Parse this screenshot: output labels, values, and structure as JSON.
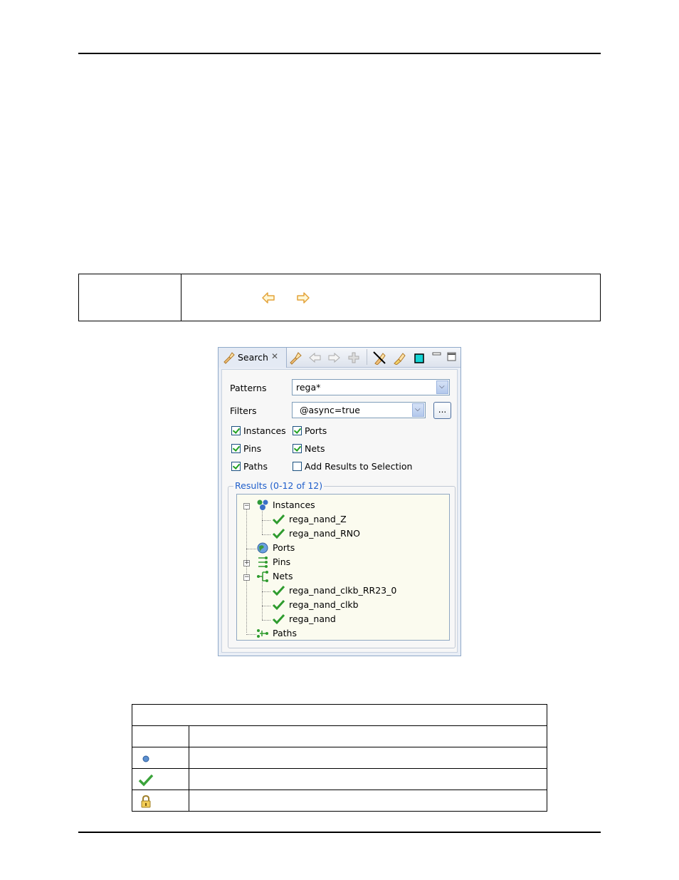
{
  "panel": {
    "tab_label": "Search",
    "patterns_label": "Patterns",
    "patterns_value": "rega*",
    "filters_label": "Filters",
    "filters_value": "@async=true",
    "browse_button": "...",
    "checkboxes": {
      "instances": {
        "label": "Instances",
        "checked": true
      },
      "ports": {
        "label": "Ports",
        "checked": true
      },
      "pins": {
        "label": "Pins",
        "checked": true
      },
      "nets": {
        "label": "Nets",
        "checked": true
      },
      "paths": {
        "label": "Paths",
        "checked": true
      },
      "add_results": {
        "label": "Add Results to Selection",
        "checked": false
      }
    },
    "results_title": "Results (0-12 of 12)",
    "tree": {
      "instances": "Instances",
      "instance_items": [
        "rega_nand_Z",
        "rega_nand_RNO"
      ],
      "ports": "Ports",
      "pins": "Pins",
      "nets": "Nets",
      "net_items": [
        "rega_nand_clkb_RR23_0",
        "rega_nand_clkb",
        "rega_nand"
      ],
      "paths": "Paths"
    }
  },
  "colors": {
    "accent": "#1f5ecb",
    "check_green": "#21a121",
    "arrow_orange": "#e3a33a"
  },
  "icons": {
    "tab": "search-flashlight-icon",
    "toolbar": [
      "flashlight-icon",
      "back-arrow-icon",
      "forward-arrow-icon",
      "pin-icon",
      "clear-icon",
      "highlight-icon",
      "color-swatch-icon",
      "minimize-icon",
      "maximize-icon"
    ],
    "legend_rows": [
      "blue-dot-icon",
      "green-check-icon",
      "lock-icon"
    ]
  }
}
